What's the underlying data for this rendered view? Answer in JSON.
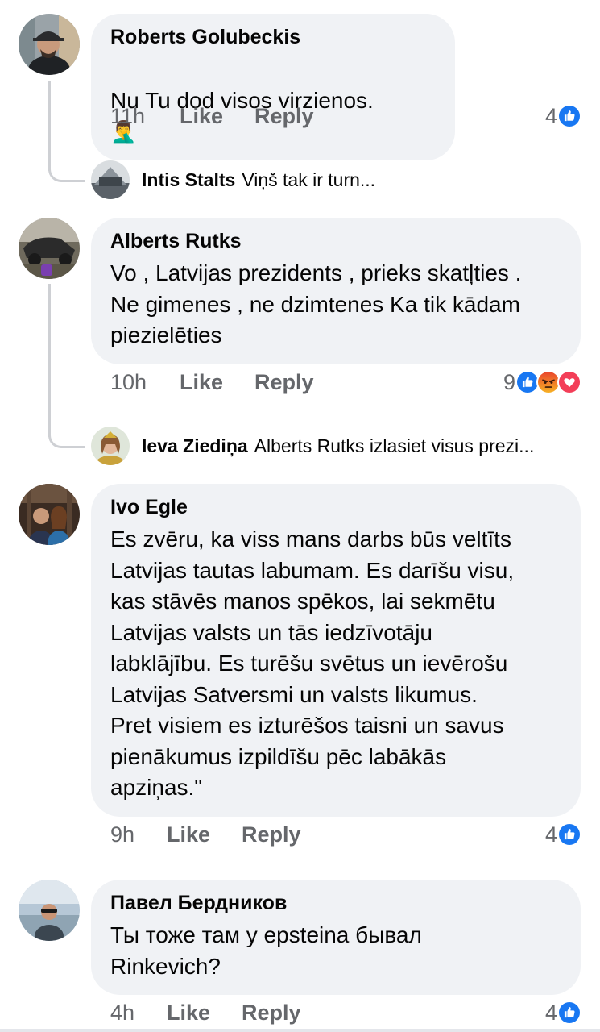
{
  "comments": [
    {
      "author": "Roberts Golubeckis",
      "text": "Nu Tu dod visos virzienos.",
      "emoji": "🤦‍♂️",
      "time": "11h",
      "like_label": "Like",
      "reply_label": "Reply",
      "reaction_count": "4",
      "reply_preview": {
        "author": "Intis Stalts",
        "text": "Viņš tak ir turn..."
      }
    },
    {
      "author": "Alberts Rutks",
      "text": "Vo , Latvijas prezidents , prieks skatļties .\nNe gimenes , ne dzimtenes Ka tik kādam\npiezielēties",
      "time": "10h",
      "like_label": "Like",
      "reply_label": "Reply",
      "reaction_count": "9",
      "reply_preview": {
        "author": "Ieva Ziediņa",
        "text": "Alberts Rutks  izlasiet visus prezi..."
      }
    },
    {
      "author": "Ivo Egle",
      "text": "Es zvēru, ka viss mans darbs būs veltīts\nLatvijas tautas labumam. Es darīšu visu,\nkas stāvēs manos spēkos, lai sekmētu\nLatvijas valsts un tās iedzīvotāju\nlabklājību. Es turēšu svētus un ievērošu\nLatvijas Satversmi un valsts likumus.\nPret visiem es izturēšos taisni un savus\npienākumus izpildīšu pēc labākās\napziņas.\"",
      "time": "9h",
      "like_label": "Like",
      "reply_label": "Reply",
      "reaction_count": "4"
    },
    {
      "author": "Павел Бердников",
      "text": "Ты тоже там у epsteina бывал\nRinkevich?",
      "time": "4h",
      "like_label": "Like",
      "reply_label": "Reply",
      "reaction_count": "4"
    }
  ],
  "colors": {
    "bubble": "#f0f2f5",
    "like_blue": "#1877f2",
    "angry_orange": "#f7b125",
    "love_red": "#f33e58",
    "secondary_text": "#65676b"
  },
  "icons": {
    "like_reaction": "thumbs-up-icon",
    "angry_reaction": "angry-face-icon",
    "love_reaction": "heart-icon"
  }
}
